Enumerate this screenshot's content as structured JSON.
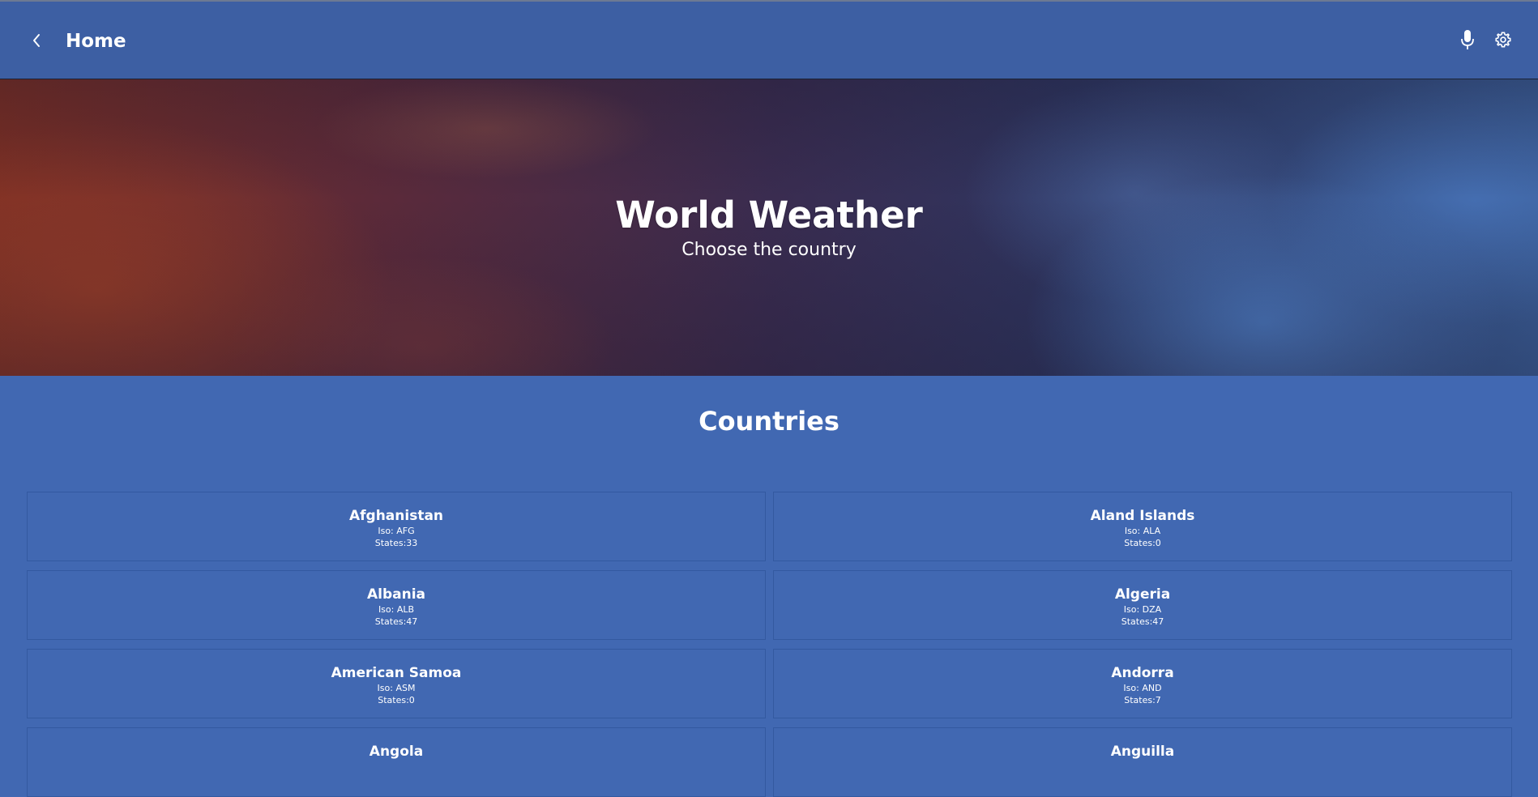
{
  "header": {
    "title": "Home",
    "back_icon": "chevron-left-icon",
    "mic_icon": "microphone-icon",
    "settings_icon": "gear-icon"
  },
  "hero": {
    "title": "World Weather",
    "subtitle": "Choose the country"
  },
  "section": {
    "title": "Countries"
  },
  "countries": [
    {
      "name": "Afghanistan",
      "iso": "Iso: AFG",
      "states": "States:33"
    },
    {
      "name": "Aland Islands",
      "iso": "Iso: ALA",
      "states": "States:0"
    },
    {
      "name": "Albania",
      "iso": "Iso: ALB",
      "states": "States:47"
    },
    {
      "name": "Algeria",
      "iso": "Iso: DZA",
      "states": "States:47"
    },
    {
      "name": "American Samoa",
      "iso": "Iso: ASM",
      "states": "States:0"
    },
    {
      "name": "Andorra",
      "iso": "Iso: AND",
      "states": "States:7"
    },
    {
      "name": "Angola",
      "iso": "",
      "states": ""
    },
    {
      "name": "Anguilla",
      "iso": "",
      "states": ""
    }
  ],
  "colors": {
    "app_bar": "#3d5fa3",
    "page_background": "#4168b2",
    "card_border": "#3359a0",
    "text": "#ffffff"
  }
}
